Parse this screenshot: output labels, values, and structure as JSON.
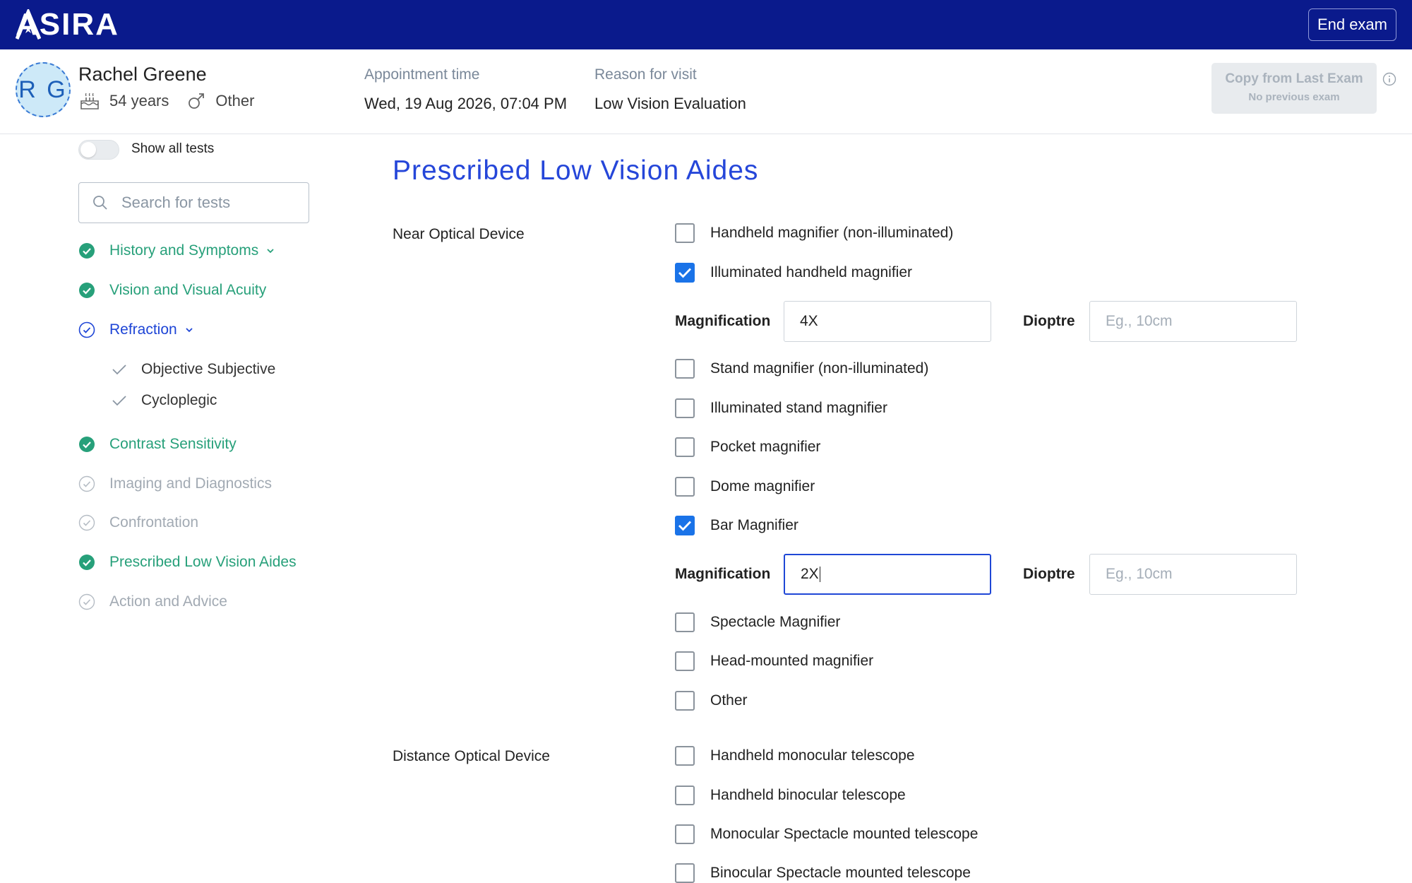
{
  "app": {
    "logo_text": "ASIRA",
    "end_exam_label": "End exam"
  },
  "patient": {
    "initials": "R G",
    "name": "Rachel Greene",
    "age": "54 years",
    "gender": "Other",
    "appointment_label": "Appointment time",
    "appointment_value": "Wed, 19 Aug 2026, 07:04 PM",
    "reason_label": "Reason for visit",
    "reason_value": "Low Vision Evaluation",
    "copy_button_label": "Copy from Last Exam",
    "copy_button_sub": "No previous exam"
  },
  "sidebar": {
    "toggle_label": "Show all tests",
    "search_placeholder": "Search for tests",
    "items": [
      {
        "label": "History and Symptoms",
        "status": "done",
        "chevron": true
      },
      {
        "label": "Vision and Visual Acuity",
        "status": "done",
        "chevron": false
      },
      {
        "label": "Refraction",
        "status": "active",
        "chevron": true
      },
      {
        "label": "Contrast Sensitivity",
        "status": "done",
        "chevron": false
      },
      {
        "label": "Imaging and Diagnostics",
        "status": "pending",
        "chevron": false
      },
      {
        "label": "Confrontation",
        "status": "pending",
        "chevron": false
      },
      {
        "label": "Prescribed Low Vision Aides",
        "status": "done",
        "chevron": false
      },
      {
        "label": "Action and Advice",
        "status": "pending",
        "chevron": false
      }
    ],
    "sub_items": [
      {
        "label": "Objective Subjective"
      },
      {
        "label": "Cycloplegic"
      }
    ]
  },
  "main": {
    "title": "Prescribed Low Vision Aides",
    "near_label": "Near Optical Device",
    "distance_label": "Distance Optical Device",
    "magnification_label": "Magnification",
    "dioptre_label": "Dioptre",
    "dioptre_placeholder": "Eg., 10cm",
    "near_options": [
      {
        "label": "Handheld magnifier (non-illuminated)",
        "checked": false
      },
      {
        "label": "Illuminated handheld magnifier",
        "checked": true,
        "magnification": "4X"
      },
      {
        "label": "Stand magnifier (non-illuminated)",
        "checked": false
      },
      {
        "label": "Illuminated stand magnifier",
        "checked": false
      },
      {
        "label": "Pocket magnifier",
        "checked": false
      },
      {
        "label": "Dome magnifier",
        "checked": false
      },
      {
        "label": "Bar Magnifier",
        "checked": true,
        "magnification": "2X"
      },
      {
        "label": "Spectacle Magnifier",
        "checked": false
      },
      {
        "label": "Head-mounted magnifier",
        "checked": false
      },
      {
        "label": "Other",
        "checked": false
      }
    ],
    "distance_options": [
      {
        "label": "Handheld monocular telescope",
        "checked": false
      },
      {
        "label": "Handheld binocular telescope",
        "checked": false
      },
      {
        "label": "Monocular Spectacle mounted telescope",
        "checked": false
      },
      {
        "label": "Binocular Spectacle mounted telescope",
        "checked": false
      }
    ]
  },
  "colors": {
    "topbar": "#0a1a8c",
    "accent": "#1e45d6",
    "done": "#27a07a",
    "checkbox_checked": "#1a73e8"
  }
}
